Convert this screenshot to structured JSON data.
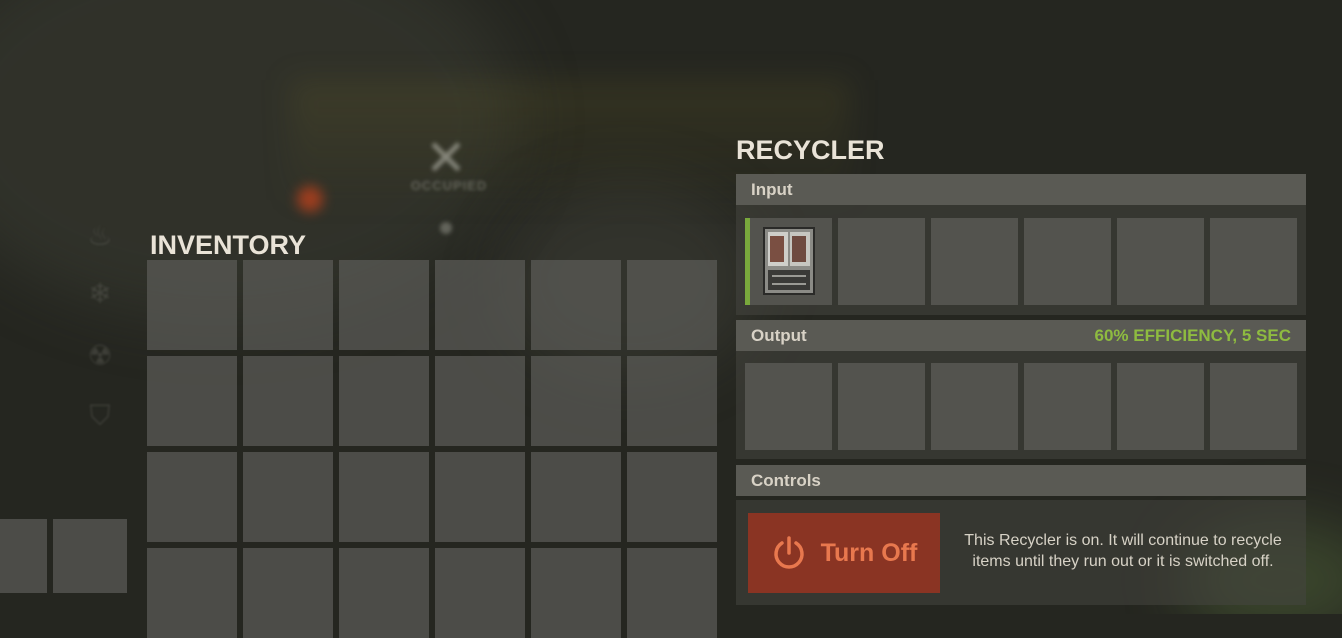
{
  "inventory": {
    "title": "INVENTORY",
    "rows": 4,
    "cols": 6
  },
  "background": {
    "occupied_text": "OCCUPIED"
  },
  "recycler": {
    "title": "RECYCLER",
    "input": {
      "label": "Input",
      "slots": [
        {
          "item": "cabinet-icon",
          "active": true
        },
        {
          "item": null
        },
        {
          "item": null
        },
        {
          "item": null
        },
        {
          "item": null
        },
        {
          "item": null
        }
      ]
    },
    "output": {
      "label": "Output",
      "efficiency": "60% EFFICIENCY, 5 SEC",
      "slots": [
        {
          "item": null
        },
        {
          "item": null
        },
        {
          "item": null
        },
        {
          "item": null
        },
        {
          "item": null
        },
        {
          "item": null
        }
      ]
    },
    "controls": {
      "label": "Controls",
      "button_label": "Turn Off",
      "button_icon": "power-icon",
      "status_text": "This Recycler is on. It will continue to recycle items until they run out or it is switched off."
    }
  },
  "colors": {
    "accent_green": "#8ebb40",
    "button_bg": "#8a3423",
    "button_text": "#e8784e"
  },
  "side_icons": [
    "fire-icon",
    "snowflake-icon",
    "radiation-icon",
    "shirt-icon"
  ]
}
